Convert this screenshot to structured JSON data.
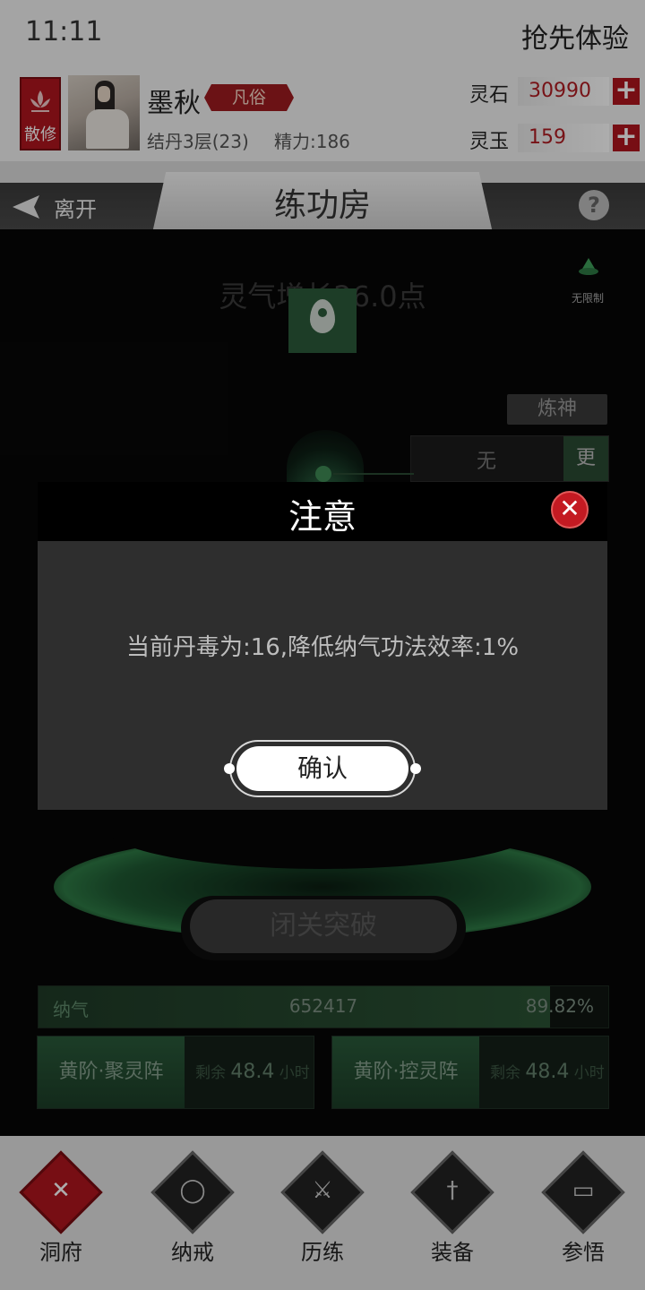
{
  "status_bar": {
    "time": "11:11",
    "early_access": "抢先体验"
  },
  "player": {
    "sect": "散修",
    "name": "墨秋",
    "rank": "凡俗",
    "realm": "结丹3层(23)",
    "stamina": "精力:186"
  },
  "resources": [
    {
      "label": "灵石",
      "value": "30990",
      "plus": "+"
    },
    {
      "label": "灵玉",
      "value": "159",
      "plus": "+"
    }
  ],
  "room": {
    "leave": "离开",
    "title": "练功房",
    "help": "?"
  },
  "cultivation": {
    "qi_gain": "灵气增长26.0点",
    "unlimited": "无限制",
    "refine": "炼神",
    "method": "无",
    "more": "更",
    "seclude": "闭关突破",
    "qi_label": "纳气",
    "qi_value": "652417",
    "qi_percent": "89.82%",
    "qi_progress": 0.8982
  },
  "arrays": [
    {
      "name": "黄阶·聚灵阵",
      "remain_prefix": "剩余",
      "hours": "48.4",
      "unit": "小时"
    },
    {
      "name": "黄阶·控灵阵",
      "remain_prefix": "剩余",
      "hours": "48.4",
      "unit": "小时"
    }
  ],
  "nav": [
    {
      "label": "洞府",
      "icon": "cave-icon",
      "active": true
    },
    {
      "label": "纳戒",
      "icon": "ring-icon",
      "active": false
    },
    {
      "label": "历练",
      "icon": "swords-icon",
      "active": false
    },
    {
      "label": "装备",
      "icon": "sword-icon",
      "active": false
    },
    {
      "label": "参悟",
      "icon": "book-icon",
      "active": false
    }
  ],
  "dialog": {
    "title": "注意",
    "close": "✕",
    "message": "当前丹毒为:16,降低纳气功法效率:1%",
    "confirm": "确认"
  },
  "colors": {
    "accent_red": "#b0161e",
    "jade_green": "#2a5a3a",
    "dialog_body": "#2e2e2e"
  }
}
